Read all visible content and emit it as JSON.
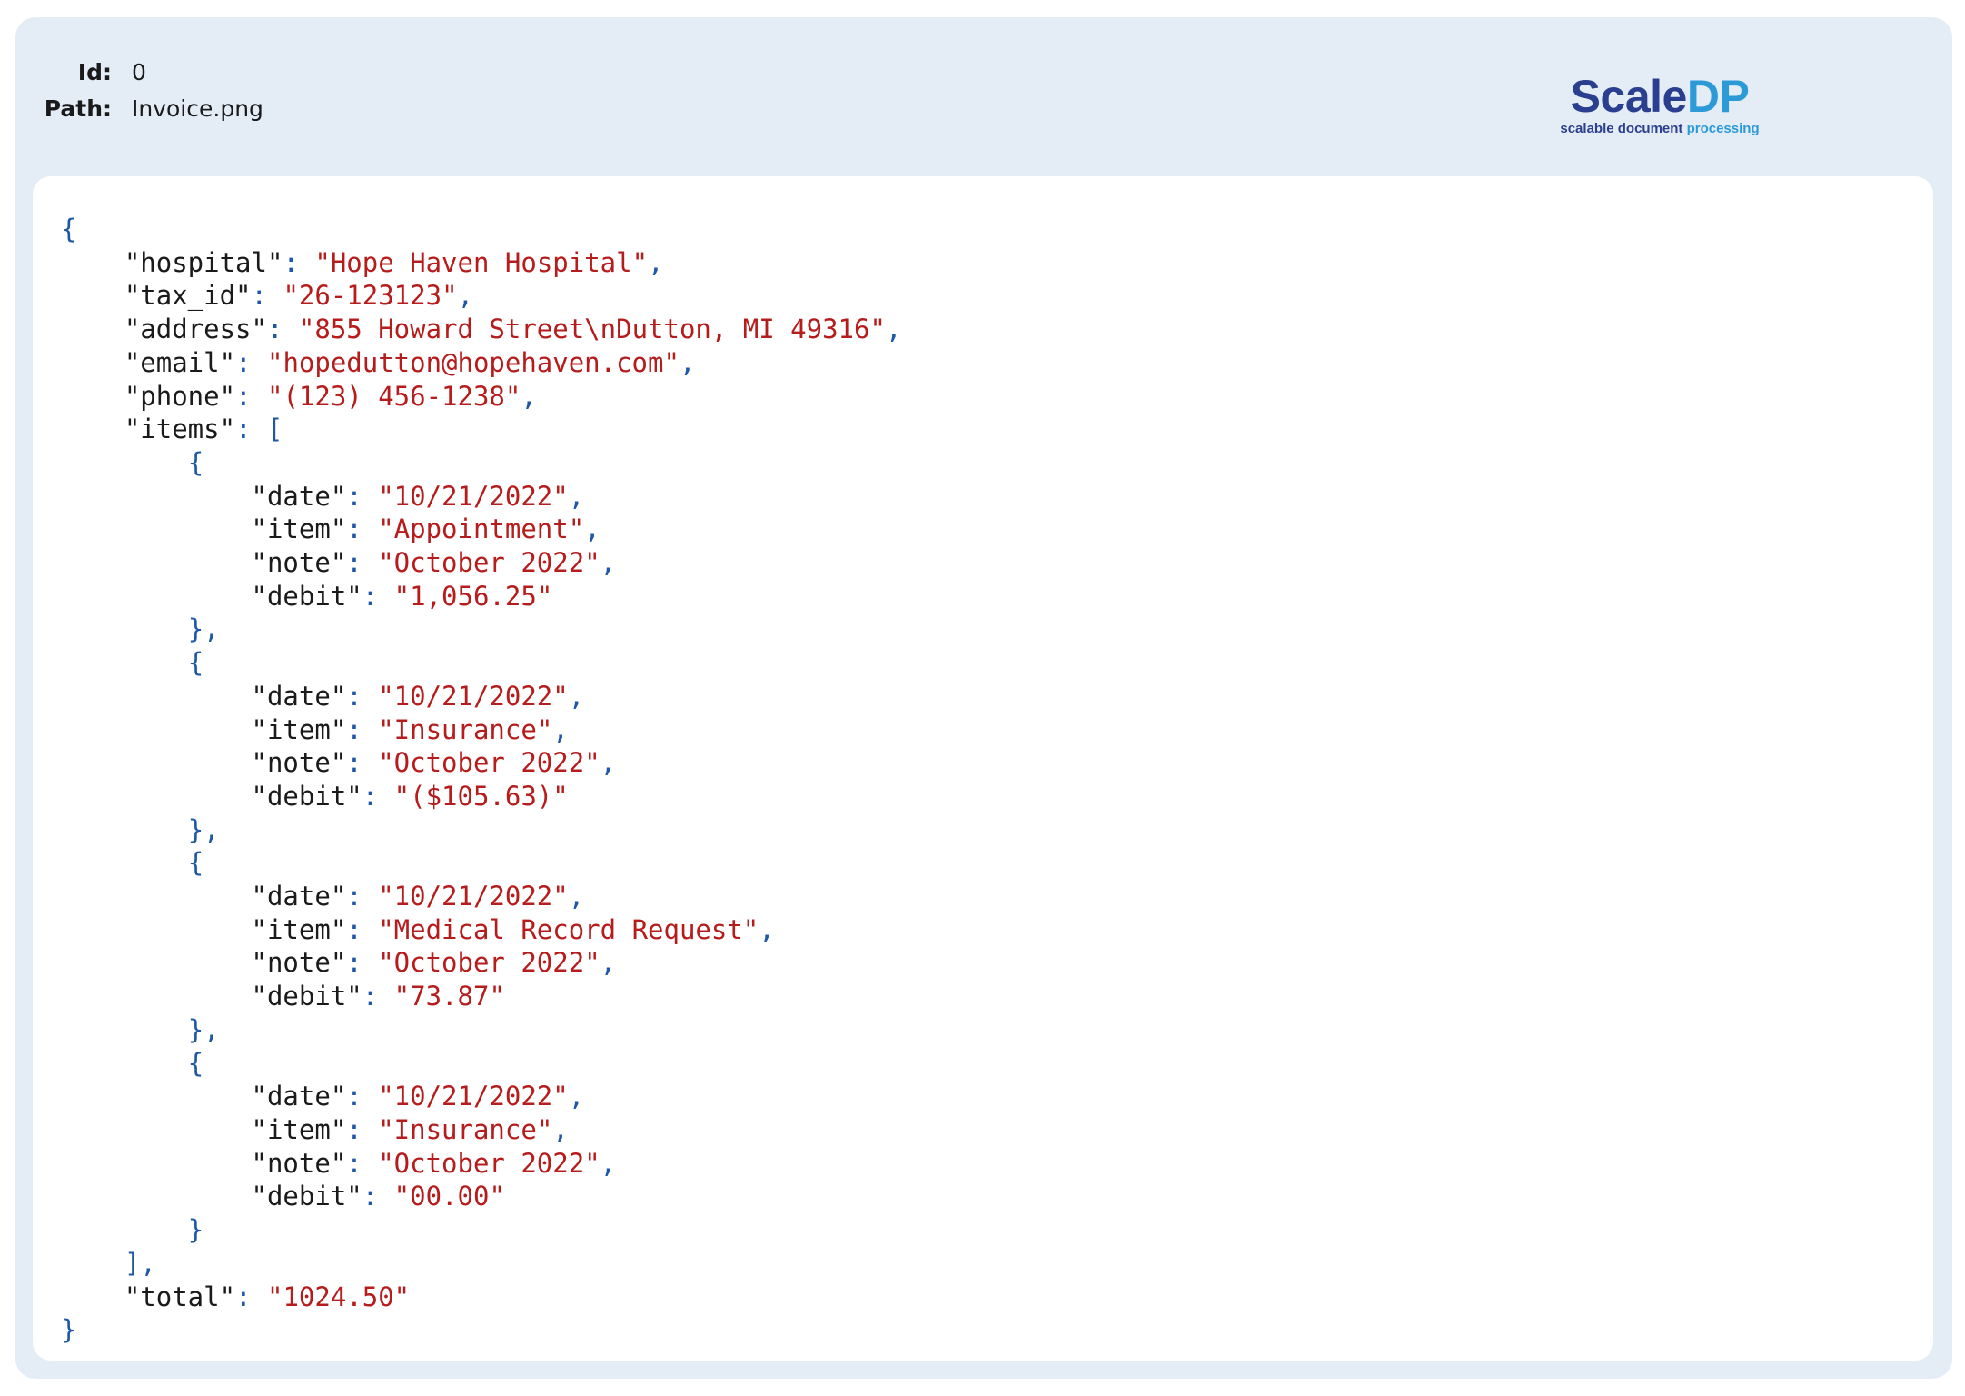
{
  "meta": {
    "id_label": "Id:",
    "id_value": "0",
    "path_label": "Path:",
    "path_value": "Invoice.png"
  },
  "logo": {
    "name_part1": "Scale",
    "name_part2": "DP",
    "tagline_part1": "scalable document",
    "tagline_part2": " processing"
  },
  "json_output": {
    "hospital": "Hope Haven Hospital",
    "tax_id": "26-123123",
    "address": "855 Howard Street\\nDutton, MI 49316",
    "email": "hopedutton@hopehaven.com",
    "phone": "(123) 456-1238",
    "items": [
      {
        "date": "10/21/2022",
        "item": "Appointment",
        "note": "October 2022",
        "debit": "1,056.25"
      },
      {
        "date": "10/21/2022",
        "item": "Insurance",
        "note": "October 2022",
        "debit": "($105.63)"
      },
      {
        "date": "10/21/2022",
        "item": "Medical Record Request",
        "note": "October 2022",
        "debit": "73.87"
      },
      {
        "date": "10/21/2022",
        "item": "Insurance",
        "note": "October 2022",
        "debit": "00.00"
      }
    ],
    "total": "1024.50"
  }
}
